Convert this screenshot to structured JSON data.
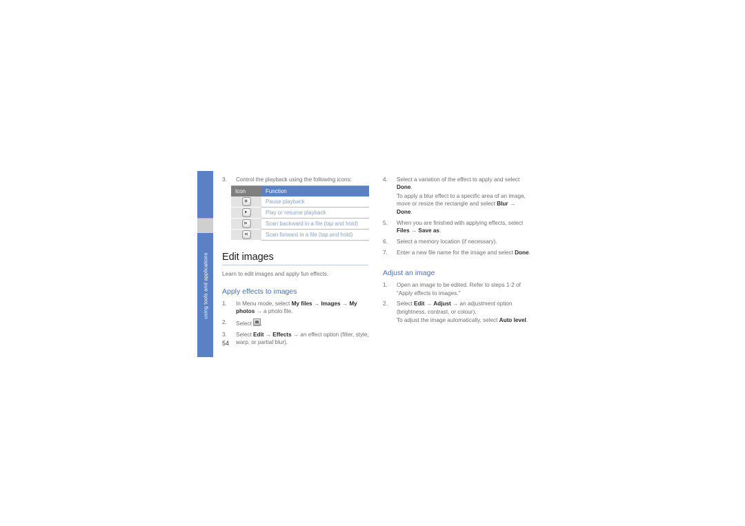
{
  "sidebar": {
    "label": "using tools and applications",
    "color": "#5b80c4",
    "marker_color": "#cfcfcf"
  },
  "page_number": "54",
  "left_column": {
    "step3": {
      "num": "3.",
      "text": "Control the playback using the following icons:"
    },
    "table": {
      "headers": [
        "Icon",
        "Function"
      ],
      "rows": [
        {
          "icon": "pause-icon",
          "function": "Pause playback"
        },
        {
          "icon": "play-icon",
          "function": "Play or resume playback"
        },
        {
          "icon": "rewind-icon",
          "function": "Scan backward in a file (tap and hold)"
        },
        {
          "icon": "fast-forward-icon",
          "function": "Scan forward in a file (tap and hold)"
        }
      ]
    },
    "heading": "Edit images",
    "intro": "Learn to edit images and apply fun effects.",
    "subheading": "Apply effects to images",
    "steps": [
      {
        "num": "1.",
        "pre": "In Menu mode, select ",
        "b1": "My files",
        "arrow1": " → ",
        "b2": "Images",
        "arrow2": " → ",
        "b3": "My photos",
        "post": " → a photo file."
      },
      {
        "num": "2.",
        "pre": "Select ",
        "icon": "edit-image-icon",
        "post": "."
      },
      {
        "num": "3.",
        "pre": "Select ",
        "b1": "Edit",
        "arrow1": " → ",
        "b2": "Effects",
        "post": " → an effect option (filter, style, warp, or partial blur)."
      }
    ]
  },
  "right_column": {
    "steps": [
      {
        "num": "4.",
        "pre": "Select a variation of the effect to apply and select ",
        "b1": "Done",
        "post": ".",
        "sub_pre": "To apply a blur effect to a specific area of an image, move or resize the rectangle and select ",
        "sub_b1": "Blur",
        "sub_arrow": " → ",
        "sub_b2": "Done",
        "sub_post": "."
      },
      {
        "num": "5.",
        "pre": "When you are finished with applying effects, select ",
        "b1": "Files",
        "arrow1": " → ",
        "b2": "Save as",
        "post": "."
      },
      {
        "num": "6.",
        "pre": "Select a memory location (if necessary)."
      },
      {
        "num": "7.",
        "pre": "Enter a new file name for the image and select ",
        "b1": "Done",
        "post": "."
      }
    ],
    "subheading": "Adjust an image",
    "steps2": [
      {
        "num": "1.",
        "pre": "Open an image to be edited. Refer to steps 1-2 of “Apply effects to images.”"
      },
      {
        "num": "2.",
        "pre": "Select ",
        "b1": "Edit",
        "arrow1": " → ",
        "b2": "Adjust",
        "post": " → an adjustment option (brightness, contrast, or colour).",
        "sub_pre": "To adjust the image automatically, select ",
        "sub_b1": "Auto level",
        "sub_post": "."
      }
    ]
  }
}
